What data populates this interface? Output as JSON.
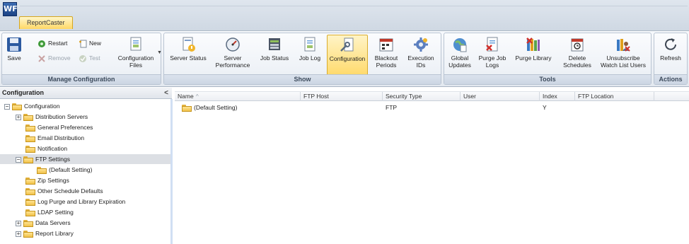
{
  "app": {
    "logo_text": "WF",
    "tab_label": "ReportCaster"
  },
  "ribbon": {
    "groups": [
      {
        "label": "Manage Configuration"
      },
      {
        "label": "Show"
      },
      {
        "label": "Tools"
      },
      {
        "label": "Actions"
      }
    ],
    "manage": {
      "save": "Save",
      "restart": "Restart",
      "new": "New",
      "remove": "Remove",
      "test": "Test",
      "config_files_1": "Configuration",
      "config_files_2": "Files"
    },
    "show": [
      {
        "l1": "Server Status",
        "l2": ""
      },
      {
        "l1": "Server",
        "l2": "Performance"
      },
      {
        "l1": "Job Status",
        "l2": ""
      },
      {
        "l1": "Job Log",
        "l2": ""
      },
      {
        "l1": "Configuration",
        "l2": ""
      },
      {
        "l1": "Blackout",
        "l2": "Periods"
      },
      {
        "l1": "Execution",
        "l2": "IDs"
      }
    ],
    "tools": [
      {
        "l1": "Global",
        "l2": "Updates"
      },
      {
        "l1": "Purge Job",
        "l2": "Logs"
      },
      {
        "l1": "Purge Library",
        "l2": ""
      },
      {
        "l1": "Delete",
        "l2": "Schedules"
      },
      {
        "l1": "Unsubscribe",
        "l2": "Watch List Users"
      }
    ],
    "actions": {
      "refresh": "Refresh"
    }
  },
  "tree": {
    "header": "Configuration",
    "collapse_glyph": "<",
    "nodes": [
      {
        "label": "Configuration"
      },
      {
        "label": "Distribution Servers"
      },
      {
        "label": "General Preferences"
      },
      {
        "label": "Email Distribution"
      },
      {
        "label": "Notification"
      },
      {
        "label": "FTP Settings"
      },
      {
        "label": "(Default Setting)"
      },
      {
        "label": "Zip Settings"
      },
      {
        "label": "Other Schedule Defaults"
      },
      {
        "label": "Log Purge and Library Expiration"
      },
      {
        "label": "LDAP Setting"
      },
      {
        "label": "Data Servers"
      },
      {
        "label": "Report Library"
      }
    ]
  },
  "grid": {
    "columns": [
      "Name",
      "FTP Host",
      "Security Type",
      "User",
      "Index",
      "FTP Location"
    ],
    "rows": [
      {
        "name": "(Default Setting)",
        "ftp_host": "",
        "security_type": "FTP",
        "user": "",
        "index": "Y",
        "ftp_location": ""
      }
    ]
  },
  "colors": {
    "active_tab": "#ffd866",
    "ribbon_bg": "#e4e9f0",
    "folder": "#f1c24a",
    "selected_row": "#dcdfe4"
  }
}
